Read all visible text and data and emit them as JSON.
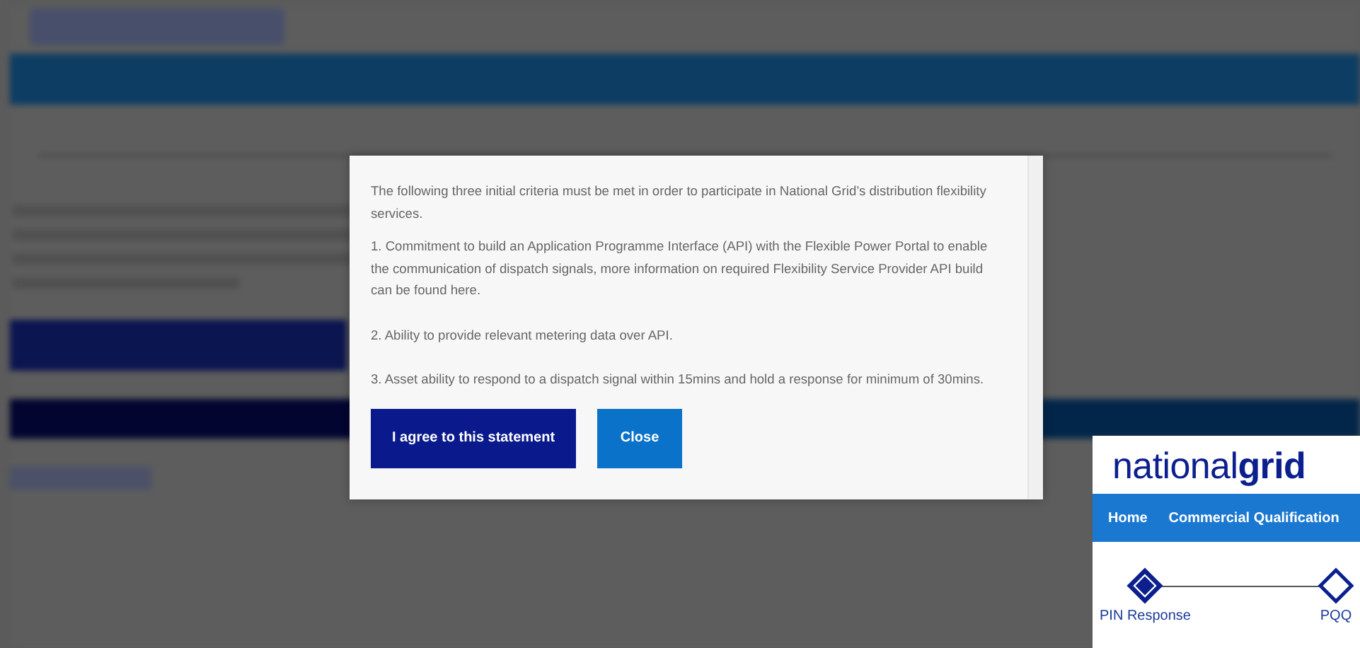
{
  "modal": {
    "paragraphs": [
      "The following three initial criteria must be met in order to participate in National Grid’s distribution flexibility services.",
      "1. Commitment to build an Application Programme Interface (API) with the Flexible Power Portal to enable the communication of dispatch signals, more information on required Flexibility Service Provider API build can be found here.",
      "2. Ability to provide relevant metering data over API.",
      "3. Asset ability to respond to a dispatch signal within 15mins and hold a response for minimum of 30mins."
    ],
    "buttons": [
      {
        "label": "I agree to this statement",
        "kind": "primary"
      },
      {
        "label": "Close",
        "kind": "secondary"
      }
    ]
  },
  "inset": {
    "logo": "national**grid**",
    "nav": [
      "Home",
      "Commercial Qualification"
    ],
    "steps": [
      {
        "label": "PIN Response",
        "selected": true
      },
      {
        "label": "PQQ",
        "selected": false
      }
    ]
  }
}
